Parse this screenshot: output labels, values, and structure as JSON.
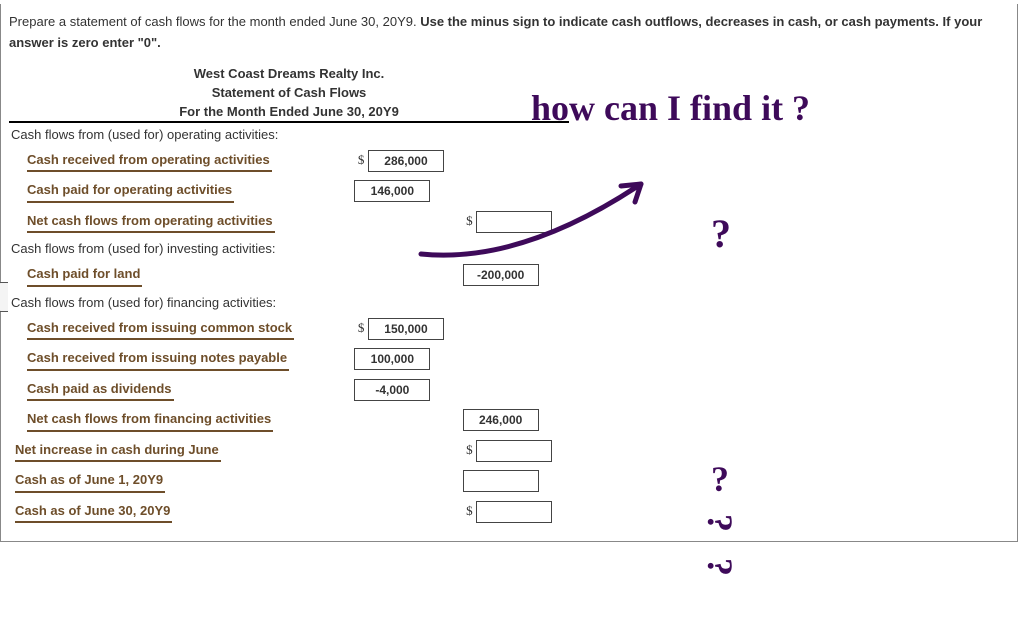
{
  "instructions": {
    "text1": "Prepare a statement of cash flows for the month ended June 30, 20Y9. ",
    "bold1": "Use the minus sign to indicate cash outflows, decreases in cash, or cash payments. If your answer is zero enter \"0\"."
  },
  "statement": {
    "header": {
      "company": "West Coast Dreams Realty Inc.",
      "title": "Statement of Cash Flows",
      "period": "For the Month Ended June 30, 20Y9"
    },
    "operating": {
      "section": "Cash flows from (used for) operating activities:",
      "received_label": "Cash received from operating activities",
      "received_value": "286,000",
      "paid_label": "Cash paid for operating activities",
      "paid_value": "146,000",
      "net_label": "Net cash flows from operating activities",
      "net_value": ""
    },
    "investing": {
      "section": "Cash flows from (used for) investing activities:",
      "land_label": "Cash paid for land",
      "land_value": "-200,000"
    },
    "financing": {
      "section": "Cash flows from (used for) financing activities:",
      "stock_label": "Cash received from issuing common stock",
      "stock_value": "150,000",
      "notes_label": "Cash received from issuing notes payable",
      "notes_value": "100,000",
      "div_label": "Cash paid as dividends",
      "div_value": "-4,000",
      "net_label": "Net cash flows from financing activities",
      "net_value": "246,000"
    },
    "summary": {
      "netinc_label": "Net increase in cash during June",
      "netinc_value": "",
      "begin_label": "Cash as of June 1, 20Y9",
      "begin_value": "",
      "end_label": "Cash as of June 30, 20Y9",
      "end_value": ""
    }
  },
  "handwriting": {
    "question": "how can I find it ?",
    "mark": "?"
  }
}
